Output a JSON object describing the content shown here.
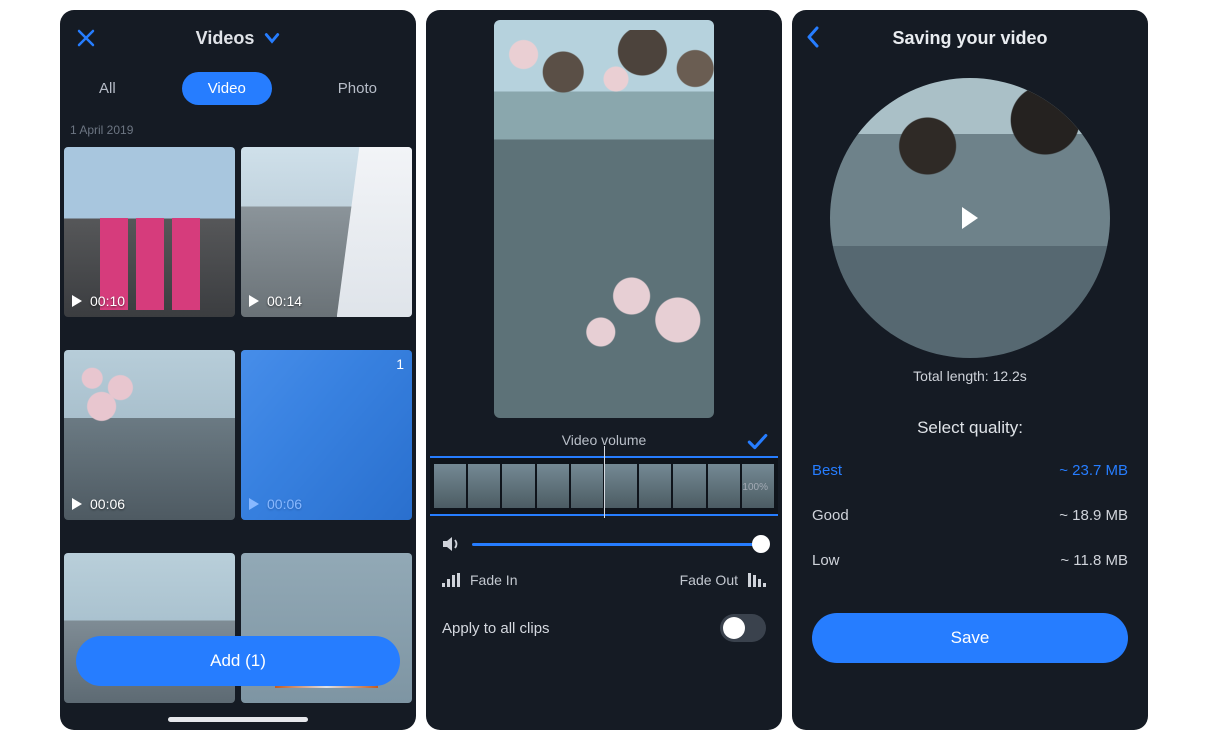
{
  "screen1": {
    "header_title": "Videos",
    "tabs": {
      "all": "All",
      "video": "Video",
      "photo": "Photo"
    },
    "date_header": "1 April 2019",
    "thumbs": [
      {
        "duration": "00:10"
      },
      {
        "duration": "00:14"
      },
      {
        "duration": "00:06"
      },
      {
        "duration": "00:06",
        "selected_badge": "1"
      },
      {
        "duration": ""
      },
      {
        "duration": ""
      }
    ],
    "add_button": "Add (1)"
  },
  "screen2": {
    "volume_title": "Video volume",
    "volume_pct": "100%",
    "fade_in": "Fade In",
    "fade_out": "Fade Out",
    "apply_all": "Apply to all clips"
  },
  "screen3": {
    "header_title": "Saving your video",
    "total_length_label": "Total length: ",
    "total_length_value": "12.2s",
    "select_quality": "Select quality:",
    "qualities": [
      {
        "name": "Best",
        "size": "~ 23.7 MB"
      },
      {
        "name": "Good",
        "size": "~ 18.9 MB"
      },
      {
        "name": "Low",
        "size": "~ 11.8 MB"
      }
    ],
    "save": "Save"
  }
}
